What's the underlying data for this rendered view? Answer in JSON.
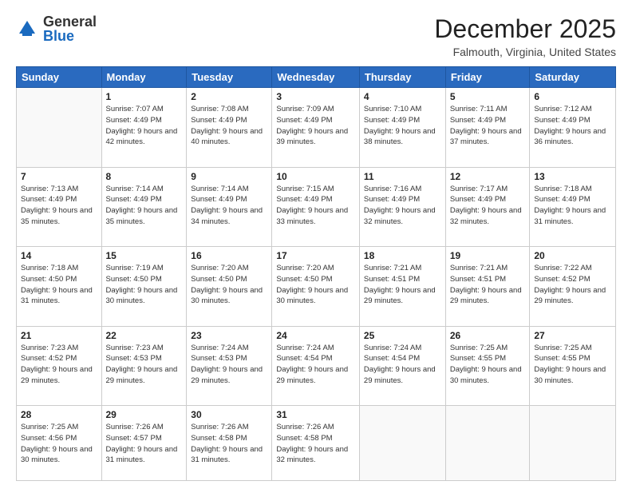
{
  "header": {
    "logo_general": "General",
    "logo_blue": "Blue",
    "month_title": "December 2025",
    "location": "Falmouth, Virginia, United States"
  },
  "days_of_week": [
    "Sunday",
    "Monday",
    "Tuesday",
    "Wednesday",
    "Thursday",
    "Friday",
    "Saturday"
  ],
  "weeks": [
    [
      {
        "num": "",
        "sunrise": "",
        "sunset": "",
        "daylight": ""
      },
      {
        "num": "1",
        "sunrise": "Sunrise: 7:07 AM",
        "sunset": "Sunset: 4:49 PM",
        "daylight": "Daylight: 9 hours and 42 minutes."
      },
      {
        "num": "2",
        "sunrise": "Sunrise: 7:08 AM",
        "sunset": "Sunset: 4:49 PM",
        "daylight": "Daylight: 9 hours and 40 minutes."
      },
      {
        "num": "3",
        "sunrise": "Sunrise: 7:09 AM",
        "sunset": "Sunset: 4:49 PM",
        "daylight": "Daylight: 9 hours and 39 minutes."
      },
      {
        "num": "4",
        "sunrise": "Sunrise: 7:10 AM",
        "sunset": "Sunset: 4:49 PM",
        "daylight": "Daylight: 9 hours and 38 minutes."
      },
      {
        "num": "5",
        "sunrise": "Sunrise: 7:11 AM",
        "sunset": "Sunset: 4:49 PM",
        "daylight": "Daylight: 9 hours and 37 minutes."
      },
      {
        "num": "6",
        "sunrise": "Sunrise: 7:12 AM",
        "sunset": "Sunset: 4:49 PM",
        "daylight": "Daylight: 9 hours and 36 minutes."
      }
    ],
    [
      {
        "num": "7",
        "sunrise": "Sunrise: 7:13 AM",
        "sunset": "Sunset: 4:49 PM",
        "daylight": "Daylight: 9 hours and 35 minutes."
      },
      {
        "num": "8",
        "sunrise": "Sunrise: 7:14 AM",
        "sunset": "Sunset: 4:49 PM",
        "daylight": "Daylight: 9 hours and 35 minutes."
      },
      {
        "num": "9",
        "sunrise": "Sunrise: 7:14 AM",
        "sunset": "Sunset: 4:49 PM",
        "daylight": "Daylight: 9 hours and 34 minutes."
      },
      {
        "num": "10",
        "sunrise": "Sunrise: 7:15 AM",
        "sunset": "Sunset: 4:49 PM",
        "daylight": "Daylight: 9 hours and 33 minutes."
      },
      {
        "num": "11",
        "sunrise": "Sunrise: 7:16 AM",
        "sunset": "Sunset: 4:49 PM",
        "daylight": "Daylight: 9 hours and 32 minutes."
      },
      {
        "num": "12",
        "sunrise": "Sunrise: 7:17 AM",
        "sunset": "Sunset: 4:49 PM",
        "daylight": "Daylight: 9 hours and 32 minutes."
      },
      {
        "num": "13",
        "sunrise": "Sunrise: 7:18 AM",
        "sunset": "Sunset: 4:49 PM",
        "daylight": "Daylight: 9 hours and 31 minutes."
      }
    ],
    [
      {
        "num": "14",
        "sunrise": "Sunrise: 7:18 AM",
        "sunset": "Sunset: 4:50 PM",
        "daylight": "Daylight: 9 hours and 31 minutes."
      },
      {
        "num": "15",
        "sunrise": "Sunrise: 7:19 AM",
        "sunset": "Sunset: 4:50 PM",
        "daylight": "Daylight: 9 hours and 30 minutes."
      },
      {
        "num": "16",
        "sunrise": "Sunrise: 7:20 AM",
        "sunset": "Sunset: 4:50 PM",
        "daylight": "Daylight: 9 hours and 30 minutes."
      },
      {
        "num": "17",
        "sunrise": "Sunrise: 7:20 AM",
        "sunset": "Sunset: 4:50 PM",
        "daylight": "Daylight: 9 hours and 30 minutes."
      },
      {
        "num": "18",
        "sunrise": "Sunrise: 7:21 AM",
        "sunset": "Sunset: 4:51 PM",
        "daylight": "Daylight: 9 hours and 29 minutes."
      },
      {
        "num": "19",
        "sunrise": "Sunrise: 7:21 AM",
        "sunset": "Sunset: 4:51 PM",
        "daylight": "Daylight: 9 hours and 29 minutes."
      },
      {
        "num": "20",
        "sunrise": "Sunrise: 7:22 AM",
        "sunset": "Sunset: 4:52 PM",
        "daylight": "Daylight: 9 hours and 29 minutes."
      }
    ],
    [
      {
        "num": "21",
        "sunrise": "Sunrise: 7:23 AM",
        "sunset": "Sunset: 4:52 PM",
        "daylight": "Daylight: 9 hours and 29 minutes."
      },
      {
        "num": "22",
        "sunrise": "Sunrise: 7:23 AM",
        "sunset": "Sunset: 4:53 PM",
        "daylight": "Daylight: 9 hours and 29 minutes."
      },
      {
        "num": "23",
        "sunrise": "Sunrise: 7:24 AM",
        "sunset": "Sunset: 4:53 PM",
        "daylight": "Daylight: 9 hours and 29 minutes."
      },
      {
        "num": "24",
        "sunrise": "Sunrise: 7:24 AM",
        "sunset": "Sunset: 4:54 PM",
        "daylight": "Daylight: 9 hours and 29 minutes."
      },
      {
        "num": "25",
        "sunrise": "Sunrise: 7:24 AM",
        "sunset": "Sunset: 4:54 PM",
        "daylight": "Daylight: 9 hours and 29 minutes."
      },
      {
        "num": "26",
        "sunrise": "Sunrise: 7:25 AM",
        "sunset": "Sunset: 4:55 PM",
        "daylight": "Daylight: 9 hours and 30 minutes."
      },
      {
        "num": "27",
        "sunrise": "Sunrise: 7:25 AM",
        "sunset": "Sunset: 4:55 PM",
        "daylight": "Daylight: 9 hours and 30 minutes."
      }
    ],
    [
      {
        "num": "28",
        "sunrise": "Sunrise: 7:25 AM",
        "sunset": "Sunset: 4:56 PM",
        "daylight": "Daylight: 9 hours and 30 minutes."
      },
      {
        "num": "29",
        "sunrise": "Sunrise: 7:26 AM",
        "sunset": "Sunset: 4:57 PM",
        "daylight": "Daylight: 9 hours and 31 minutes."
      },
      {
        "num": "30",
        "sunrise": "Sunrise: 7:26 AM",
        "sunset": "Sunset: 4:58 PM",
        "daylight": "Daylight: 9 hours and 31 minutes."
      },
      {
        "num": "31",
        "sunrise": "Sunrise: 7:26 AM",
        "sunset": "Sunset: 4:58 PM",
        "daylight": "Daylight: 9 hours and 32 minutes."
      },
      {
        "num": "",
        "sunrise": "",
        "sunset": "",
        "daylight": ""
      },
      {
        "num": "",
        "sunrise": "",
        "sunset": "",
        "daylight": ""
      },
      {
        "num": "",
        "sunrise": "",
        "sunset": "",
        "daylight": ""
      }
    ]
  ]
}
